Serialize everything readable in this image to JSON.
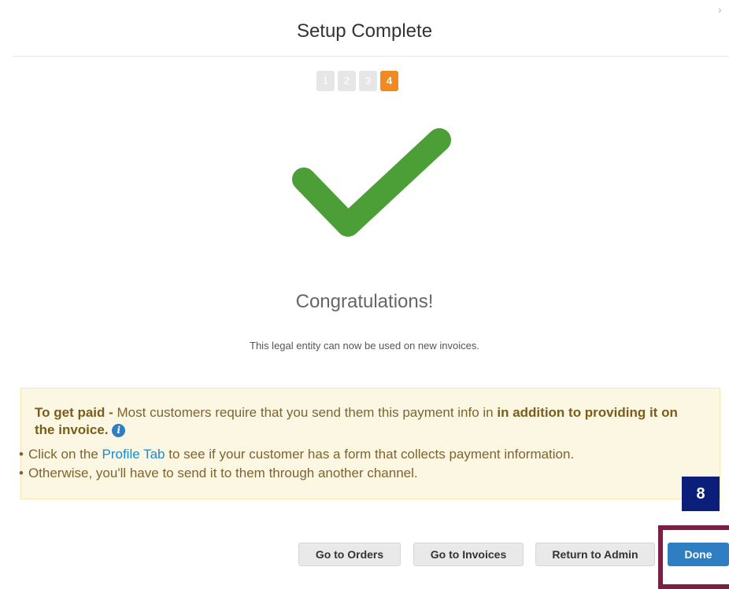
{
  "header": {
    "title": "Setup Complete",
    "close_glyph": "›"
  },
  "steps": [
    "1",
    "2",
    "3",
    "4"
  ],
  "active_step": 4,
  "success": {
    "icon": "checkmark-icon",
    "headline": "Congratulations!",
    "message": "This legal entity can now be used on new invoices."
  },
  "notice": {
    "lead_bold": "To get paid -",
    "lead_text": " Most customers require that you send them this payment info in ",
    "lead_emphasis": "in addition to providing it on the invoice.",
    "info_glyph": "i",
    "bullet1_before": "Click on the ",
    "bullet1_link": "Profile Tab",
    "bullet1_after": " to see if your customer has a form that collects payment information.",
    "bullet2": "Otherwise, you'll have to send it to them through another channel."
  },
  "annotation": {
    "step_number": "8"
  },
  "footer": {
    "go_to_orders": "Go to Orders",
    "go_to_invoices": "Go to Invoices",
    "return_to_admin": "Return to Admin",
    "done": "Done"
  },
  "colors": {
    "accent_orange": "#f28a22",
    "success_green": "#4c9e36",
    "primary_blue": "#2f7ec1"
  }
}
